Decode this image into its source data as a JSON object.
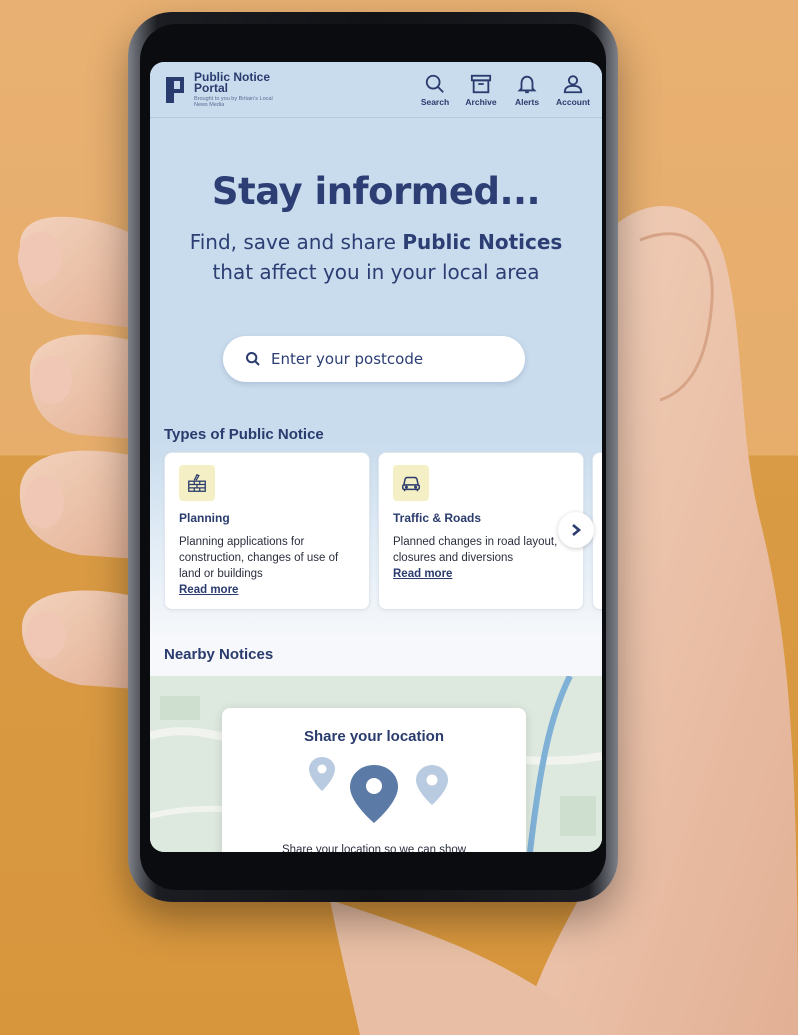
{
  "colors": {
    "brand_navy": "#2a3b6d",
    "hero_background": "#c9dced",
    "card_icon_background": "#f4efc4",
    "photo_background": "#e6ad6b"
  },
  "header": {
    "brand_title": "Public Notice Portal",
    "brand_subtitle": "Brought to you by Britain's Local News Media",
    "nav": [
      {
        "label": "Search",
        "icon": "search-icon"
      },
      {
        "label": "Archive",
        "icon": "archive-icon"
      },
      {
        "label": "Alerts",
        "icon": "bell-icon"
      },
      {
        "label": "Account",
        "icon": "user-icon"
      }
    ]
  },
  "hero": {
    "title": "Stay informed...",
    "subtitle_lead": "Find, save and share ",
    "subtitle_bold": "Public Notices",
    "subtitle_tail": " that affect you in your local area",
    "search_placeholder": "Enter your postcode"
  },
  "types": {
    "heading": "Types of Public Notice",
    "cards": [
      {
        "icon": "brick-wall-icon",
        "title": "Planning",
        "text": "Planning applications for construction, changes of use of land or buildings",
        "link": "Read more"
      },
      {
        "icon": "car-icon",
        "title": "Traffic & Roads",
        "text": "Planned changes in road layout, closures and diversions",
        "link": "Read more"
      }
    ]
  },
  "nearby": {
    "heading": "Nearby Notices",
    "share_title": "Share your location",
    "share_text": "Share your location so we can show"
  }
}
